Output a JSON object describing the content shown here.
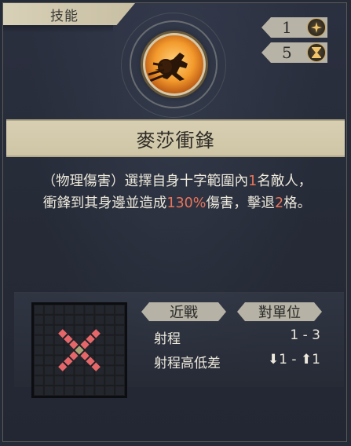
{
  "tab": {
    "label": "技能"
  },
  "stats": {
    "ap": {
      "value": "1",
      "icon": "star-sparkle-icon"
    },
    "cooldown": {
      "value": "5",
      "icon": "hourglass-icon"
    }
  },
  "skill": {
    "name": "麥莎衝鋒",
    "description": {
      "part1": "（物理傷害）選擇自身十字範圍內",
      "count": "1",
      "part2": "名敵人，",
      "part3": "衝鋒到其身邊並造成",
      "percent": "130%",
      "part4": "傷害，擊退",
      "knockback": "2",
      "part5": "格。"
    }
  },
  "details": {
    "range_type": "近戰",
    "target_type": "對單位",
    "range_label": "射程",
    "range_value": "1 - 3",
    "height_label": "射程高低差",
    "height_value": "⬇1 - ⬆1"
  },
  "colors": {
    "highlight": "#e8745a",
    "cell_active": "#e5676a",
    "cell_center": "#a8a477",
    "banner": "#d8cfb3"
  }
}
